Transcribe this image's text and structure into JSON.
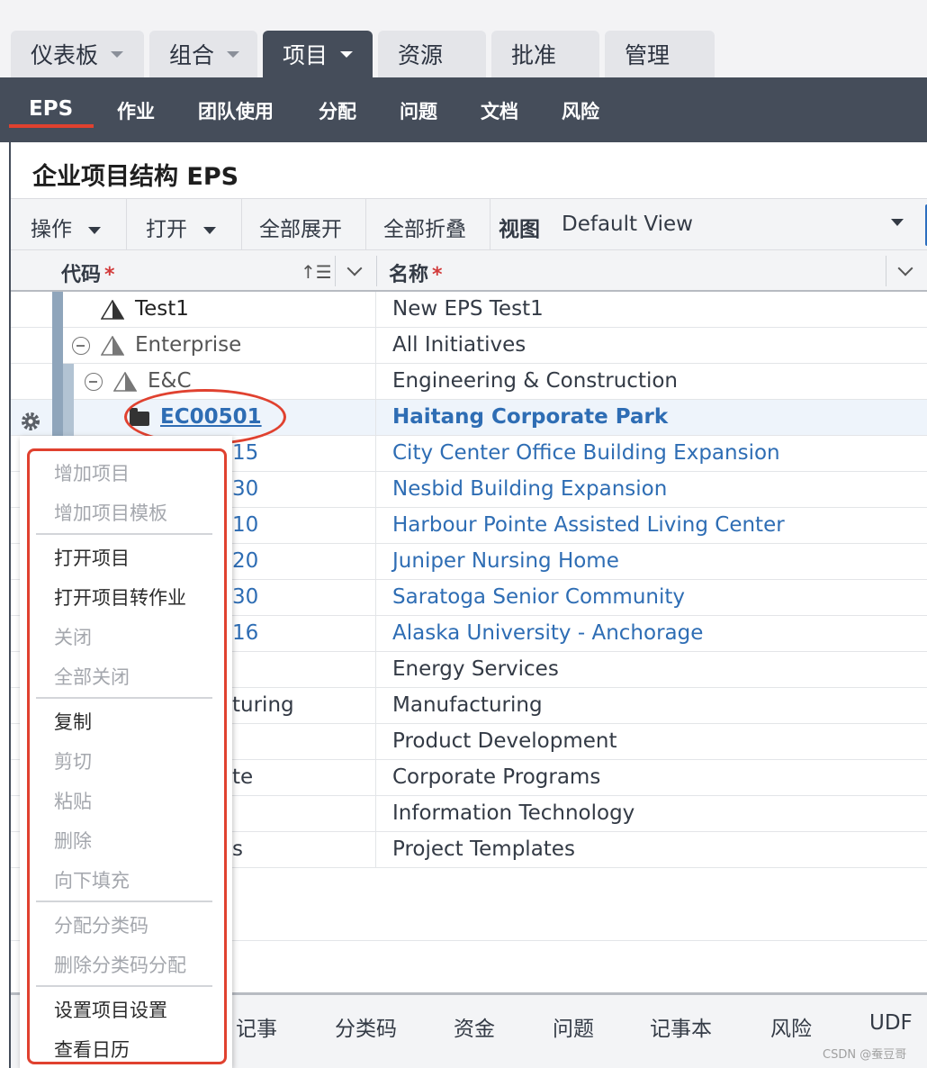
{
  "top_tabs": [
    {
      "label": "仪表板",
      "has_caret": true
    },
    {
      "label": "组合",
      "has_caret": true
    },
    {
      "label": "项目",
      "has_caret": true,
      "active": true
    },
    {
      "label": "资源",
      "has_caret": false
    },
    {
      "label": "批准",
      "has_caret": false
    },
    {
      "label": "管理",
      "has_caret": false
    }
  ],
  "subnav": [
    "EPS",
    "作业",
    "团队使用",
    "分配",
    "问题",
    "文档",
    "风险"
  ],
  "panel": {
    "title": "企业项目结构 EPS",
    "toolbar": {
      "actions": "操作",
      "open": "打开",
      "expand_all": "全部展开",
      "collapse_all": "全部折叠",
      "view_label": "视图",
      "view_value": "Default View"
    },
    "columns": {
      "code": "代码",
      "name": "名称",
      "required_mark": "*"
    }
  },
  "rows": [
    {
      "code": "Test1",
      "name": "New EPS Test1"
    },
    {
      "code": "Enterprise",
      "name": "All Initiatives"
    },
    {
      "code": "E&C",
      "name": "Engineering & Construction"
    },
    {
      "code": "EC00501",
      "name": "Haitang Corporate Park"
    },
    {
      "code": "15",
      "name": "City Center Office Building Expansion"
    },
    {
      "code": "30",
      "name": "Nesbid Building Expansion"
    },
    {
      "code": "10",
      "name": "Harbour Pointe Assisted Living Center"
    },
    {
      "code": "20",
      "name": "Juniper Nursing Home"
    },
    {
      "code": "30",
      "name": "Saratoga Senior Community"
    },
    {
      "code": "16",
      "name": "Alaska University - Anchorage"
    },
    {
      "code": "",
      "name": "Energy Services"
    },
    {
      "code": "turing",
      "name": "Manufacturing"
    },
    {
      "code": "",
      "name": "Product Development"
    },
    {
      "code": "te",
      "name": "Corporate Programs"
    },
    {
      "code": "",
      "name": "Information Technology"
    },
    {
      "code": "s",
      "name": "Project Templates"
    }
  ],
  "context_menu": {
    "add_project": "增加项目",
    "add_project_template": "增加项目模板",
    "open_project": "打开项目",
    "open_project_to_activities": "打开项目转作业",
    "close": "关闭",
    "close_all": "全部关闭",
    "copy": "复制",
    "cut": "剪切",
    "paste": "粘贴",
    "delete": "删除",
    "fill_down": "向下填充",
    "assign_codes": "分配分类码",
    "delete_code_assignment": "删除分类码分配",
    "set_project_settings": "设置项目设置",
    "view_calendar": "查看日历"
  },
  "bottom_tabs": [
    "记事",
    "分类码",
    "资金",
    "问题",
    "记事本",
    "风险",
    "UDF"
  ],
  "watermark": "CSDN @蚕豆哥",
  "colors": {
    "accent_red": "#e0412f",
    "link_blue": "#2e6db4",
    "nav_dark": "#454d5a"
  }
}
